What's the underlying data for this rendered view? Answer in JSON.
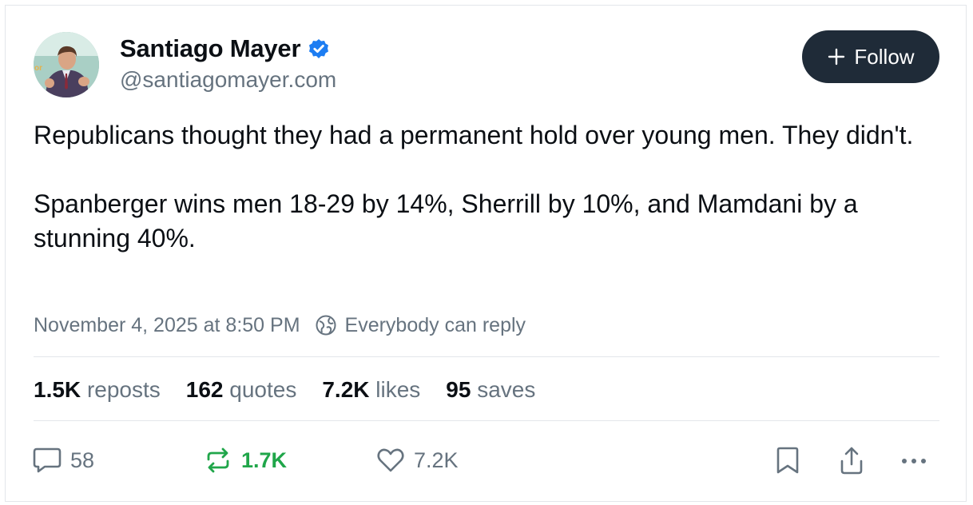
{
  "author": {
    "name": "Santiago Mayer",
    "handle": "@santiagomayer.com",
    "verified": true
  },
  "follow_button": {
    "label": "Follow",
    "icon": "plus-icon"
  },
  "post": {
    "paragraphs": [
      "Republicans thought they had a permanent hold over young men. They didn't.",
      "Spanberger wins men 18-29 by 14%, Sherrill by 10%, and Mamdani by a stunning 40%."
    ],
    "timestamp": "November 4, 2025 at 8:50 PM",
    "reply_setting": "Everybody can reply"
  },
  "stats": [
    {
      "count": "1.5K",
      "label": "reposts"
    },
    {
      "count": "162",
      "label": "quotes"
    },
    {
      "count": "7.2K",
      "label": "likes"
    },
    {
      "count": "95",
      "label": "saves"
    }
  ],
  "actions": {
    "reply_count": "58",
    "repost_count": "1.7K",
    "like_count": "7.2K"
  },
  "colors": {
    "accent_blue": "#1d7df2",
    "repost_green": "#20a64a",
    "muted_text": "#66737f",
    "follow_bg": "#1f2b38"
  }
}
